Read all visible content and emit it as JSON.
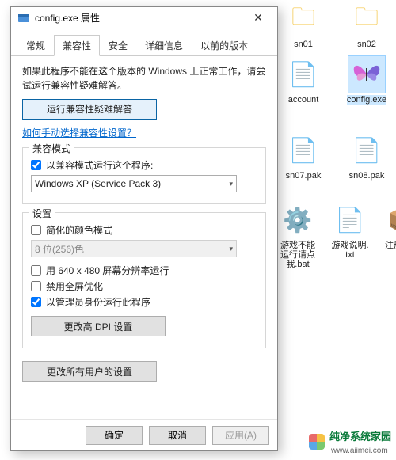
{
  "dialog": {
    "title": "config.exe 属性",
    "tabs": [
      "常规",
      "兼容性",
      "安全",
      "详细信息",
      "以前的版本"
    ],
    "activeTab": 1,
    "intro": "如果此程序不能在这个版本的 Windows 上正常工作，请尝试运行兼容性疑难解答。",
    "troubleshoot": "运行兼容性疑难解答",
    "helpLink": "如何手动选择兼容性设置？",
    "compatGroup": {
      "title": "兼容模式",
      "checkbox": "以兼容模式运行这个程序:",
      "checked": true,
      "selectValue": "Windows XP (Service Pack 3)"
    },
    "settingsGroup": {
      "title": "设置",
      "reducedColor": {
        "label": "简化的颜色模式",
        "checked": false
      },
      "colorDepth": "8 位(256)色",
      "lowRes": {
        "label": "用 640 x 480 屏幕分辨率运行",
        "checked": false
      },
      "disableFullscreen": {
        "label": "禁用全屏优化",
        "checked": false
      },
      "runAsAdmin": {
        "label": "以管理员身份运行此程序",
        "checked": true
      },
      "dpiBtn": "更改高 DPI 设置"
    },
    "allUsersBtn": "更改所有用户的设置",
    "footer": {
      "ok": "确定",
      "cancel": "取消",
      "apply": "应用(A)"
    }
  },
  "desktop": {
    "row1": [
      "sn01",
      "sn02"
    ],
    "row2": [
      "account",
      "config.exe"
    ],
    "row3": [
      "sn07.pak",
      "sn08.pak"
    ],
    "row4": [
      "游戏不能运行请点我.bat",
      "游戏说明.txt",
      "注册蜂鸟"
    ]
  },
  "watermark": {
    "text": "纯净系统家园",
    "url": "www.aiimei.com"
  }
}
